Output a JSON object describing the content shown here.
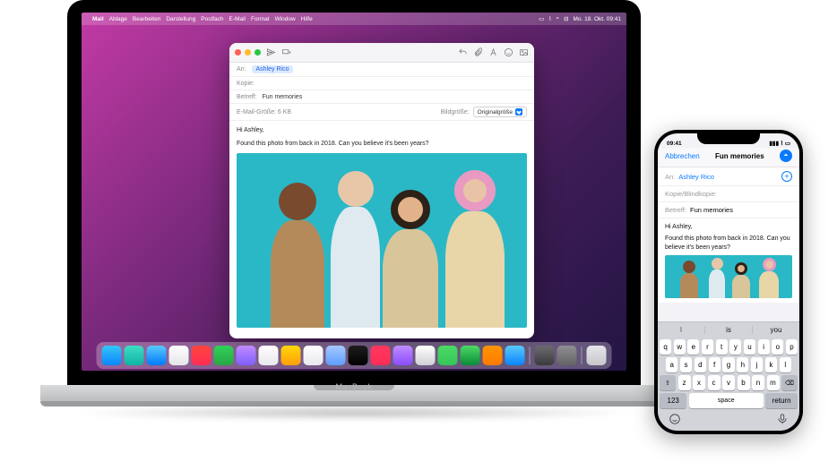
{
  "mac": {
    "menubar": {
      "app": "Mail",
      "items": [
        "Ablage",
        "Bearbeiten",
        "Darstellung",
        "Postfach",
        "E-Mail",
        "Format",
        "Window",
        "Hilfe"
      ],
      "datetime": "Mo. 18. Okt.  09:41"
    },
    "compose": {
      "to_label": "An:",
      "to_value": "Ashley Rico",
      "cc_label": "Kopie:",
      "subject_label": "Betreff:",
      "subject_value": "Fun memories",
      "emailsize_label": "E-Mail-Größe: 6 KB",
      "imagesize_label": "Bildgröße:",
      "imagesize_value": "Originalgröße",
      "greeting": "Hi Ashley,",
      "body_line": "Found this photo from back in 2018. Can you believe it's been years?"
    },
    "brand": "MacBook"
  },
  "iphone": {
    "status_time": "09:41",
    "cancel": "Abbrechen",
    "title": "Fun memories",
    "to_label": "An:",
    "to_value": "Ashley Rico",
    "ccbcc_label": "Kopie/Blindkopie:",
    "subject_label": "Betreff:",
    "subject_value": "Fun memories",
    "greeting": "Hi Ashley,",
    "body_line": "Found this photo from back in 2018. Can you believe it's been years?",
    "predictive": [
      "I",
      "is",
      "you"
    ],
    "keys_row1": [
      "q",
      "w",
      "e",
      "r",
      "t",
      "y",
      "u",
      "i",
      "o",
      "p"
    ],
    "keys_row2": [
      "a",
      "s",
      "d",
      "f",
      "g",
      "h",
      "j",
      "k",
      "l"
    ],
    "keys_row3": [
      "z",
      "x",
      "c",
      "v",
      "b",
      "n",
      "m"
    ],
    "shift": "⇧",
    "backspace": "⌫",
    "numkey": "123",
    "space": "space",
    "return": "return"
  },
  "dock_colors": [
    "linear-gradient(#34c6f4,#0a84ff)",
    "linear-gradient(#3edcc4,#0fb5a4)",
    "linear-gradient(#5ac8fa,#007aff)",
    "linear-gradient(#fff,#e5e5ea)",
    "linear-gradient(#ff453a,#ff2d55)",
    "linear-gradient(#30d158,#28a745)",
    "linear-gradient(#c18bff,#7d5fff)",
    "linear-gradient(#fff,#e8e8ee)",
    "linear-gradient(#ffd60a,#ff9f0a)",
    "linear-gradient(#fff,#e8e8ee)",
    "linear-gradient(#a6c8ff,#5e9eff)",
    "linear-gradient(#1e1e1e,#000)",
    "linear-gradient(#ff375f,#ff2d55)",
    "linear-gradient(#c18bff,#8a4dff)",
    "linear-gradient(#fff,#d0d0d5)",
    "linear-gradient(#4cd964,#34c759)",
    "linear-gradient(#4cd964,#0a8a3a)",
    "linear-gradient(#ff9500,#ff7a00)",
    "linear-gradient(#5ac8fa,#0a84ff)",
    "linear-gradient(#6b6b70,#3a3a3e)",
    "linear-gradient(#8e8e93,#636366)"
  ]
}
